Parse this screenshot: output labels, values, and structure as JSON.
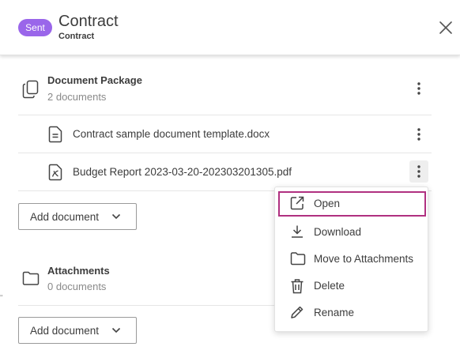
{
  "header": {
    "badge": "Sent",
    "title": "Contract",
    "subtitle": "Contract",
    "close_icon": "close-icon"
  },
  "document_package": {
    "title": "Document Package",
    "count": "2 documents",
    "icon": "copy-documents-icon",
    "files": [
      {
        "name": "Contract sample document template.docx",
        "icon": "document-icon"
      },
      {
        "name": "Budget Report 2023-03-20-202303201305.pdf",
        "icon": "pdf-icon"
      }
    ],
    "add_label": "Add document"
  },
  "attachments": {
    "title": "Attachments",
    "count": "0 documents",
    "icon": "folder-icon",
    "add_label": "Add document"
  },
  "side_mark": "\"",
  "context_menu": {
    "items": [
      {
        "label": "Open",
        "icon": "open-external-icon",
        "highlighted": true
      },
      {
        "label": "Download",
        "icon": "download-icon"
      },
      {
        "label": "Move to Attachments",
        "icon": "folder-icon"
      },
      {
        "label": "Delete",
        "icon": "trash-icon"
      },
      {
        "label": "Rename",
        "icon": "pencil-icon"
      }
    ]
  },
  "colors": {
    "badge": "#9a66ea",
    "highlight_border": "#b03080",
    "text": "#3c3c3c",
    "muted": "#8a8a8a"
  }
}
